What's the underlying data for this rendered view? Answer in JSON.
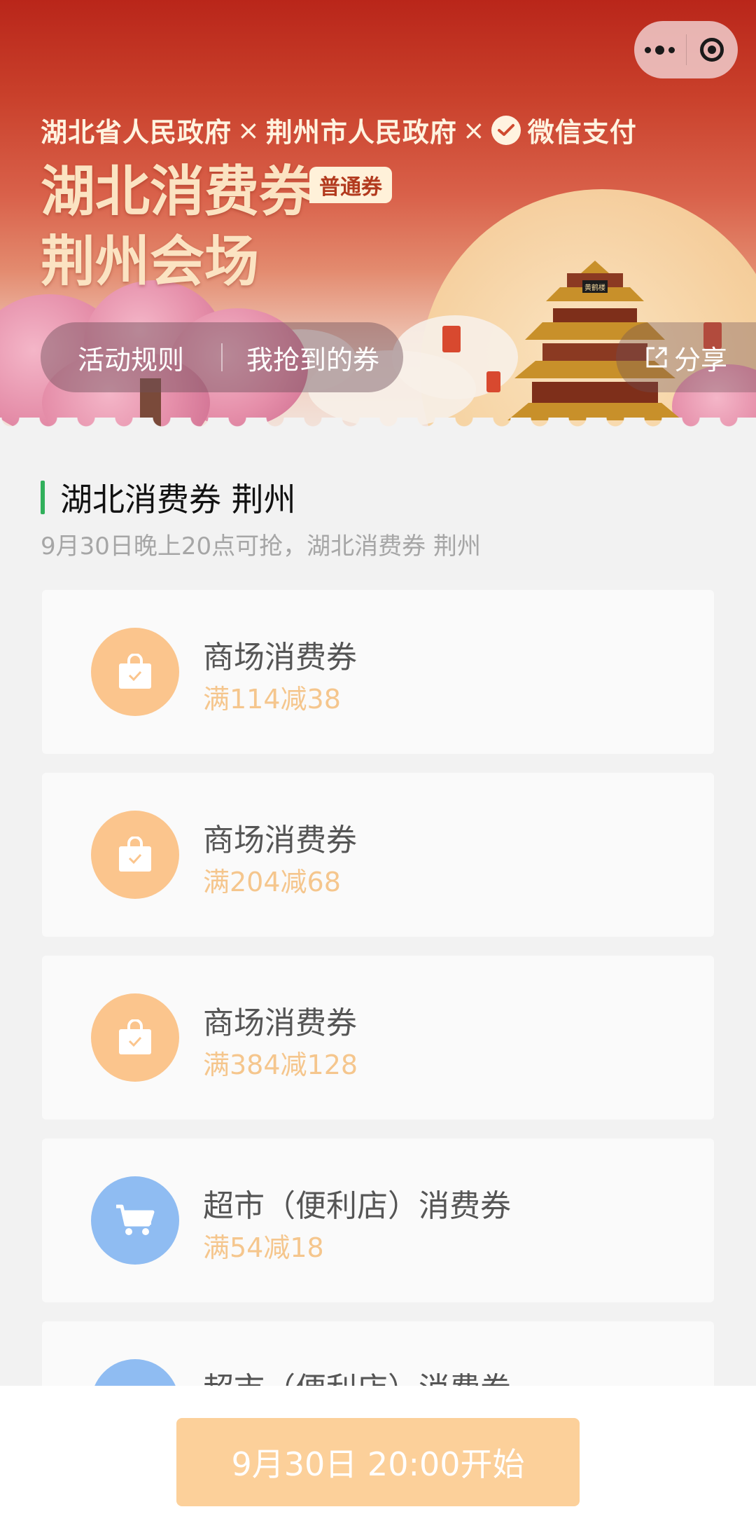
{
  "hero": {
    "sponsors": [
      "湖北省人民政府",
      "荆州市人民政府",
      "微信支付"
    ],
    "separator": "×",
    "title_line1": "湖北消费券",
    "title_line2": "荆州会场",
    "badge": "普通券",
    "nav": {
      "rules": "活动规则",
      "my_coupons": "我抢到的券"
    },
    "share": "分享",
    "tower_plaque": "黄鹤楼"
  },
  "section": {
    "title": "湖北消费券 荆州",
    "subtitle": "9月30日晚上20点可抢，湖北消费券 荆州"
  },
  "coupons": [
    {
      "name": "商场消费券",
      "deal": "满114减38",
      "icon": "shopping-bag-icon"
    },
    {
      "name": "商场消费券",
      "deal": "满204减68",
      "icon": "shopping-bag-icon"
    },
    {
      "name": "商场消费券",
      "deal": "满384减128",
      "icon": "shopping-bag-icon"
    },
    {
      "name": "超市（便利店）消费券",
      "deal": "满54减18",
      "icon": "shopping-cart-icon"
    },
    {
      "name": "超市（便利店）消费券",
      "deal": "",
      "icon": "shopping-cart-icon"
    }
  ],
  "bottom": {
    "button": "9月30日 20:00开始"
  },
  "colors": {
    "accent_green": "#31b05b",
    "deal_orange": "#f5c68d",
    "bag_circle": "#fbc58d",
    "cart_circle": "#8fbcf2",
    "button": "#fcd09a"
  }
}
